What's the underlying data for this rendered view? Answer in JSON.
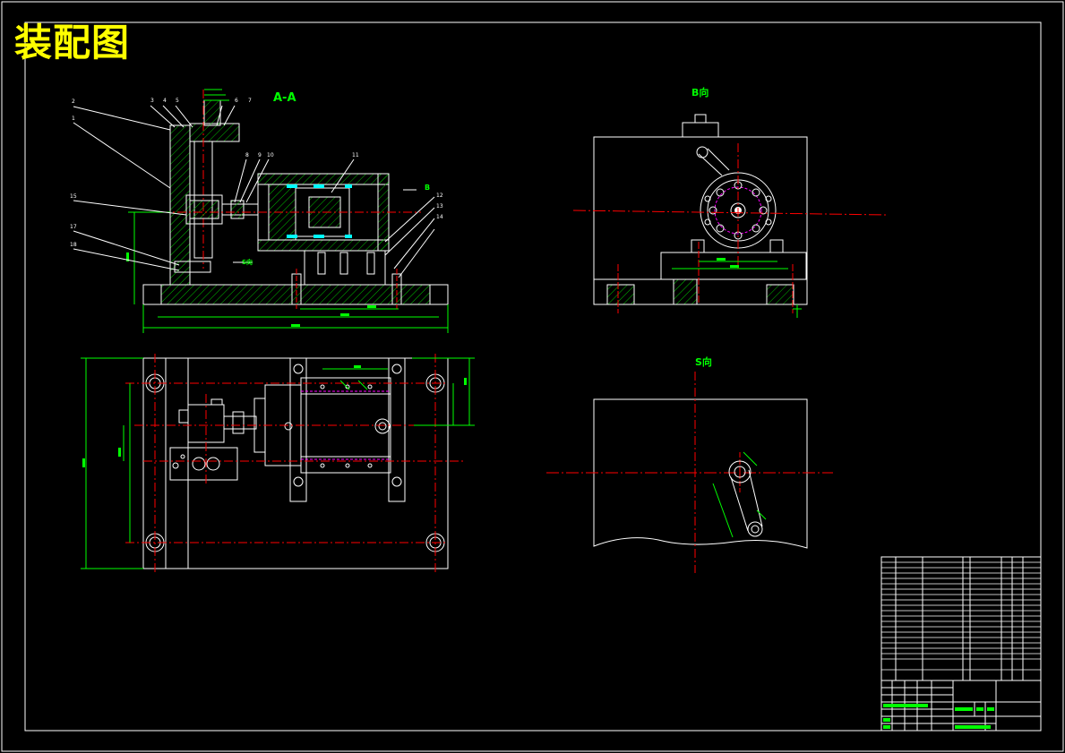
{
  "drawing": {
    "title": "装配图",
    "views": {
      "section_label": "A-A",
      "b_view_label": "B向",
      "s_view_label": "S向",
      "b_arrow_label": "B",
      "s_arrow_label": "S向"
    },
    "balloons": {
      "left_top": [
        "2",
        "3",
        "4",
        "5",
        "6",
        "7"
      ],
      "left_side": [
        "1",
        "15",
        "17",
        "18"
      ],
      "mid_top": [
        "8",
        "9",
        "10",
        "11"
      ],
      "right_side": [
        "12",
        "13",
        "14"
      ]
    },
    "colors": {
      "background": "#000000",
      "outline": "#ffffff",
      "centerline": "#ff0000",
      "dimension": "#00ff00",
      "hatch": "#00ff00",
      "leader": "#ffffff",
      "title": "#ffff00",
      "highlight": "#00ffff",
      "hidden": "#ff00ff"
    }
  }
}
